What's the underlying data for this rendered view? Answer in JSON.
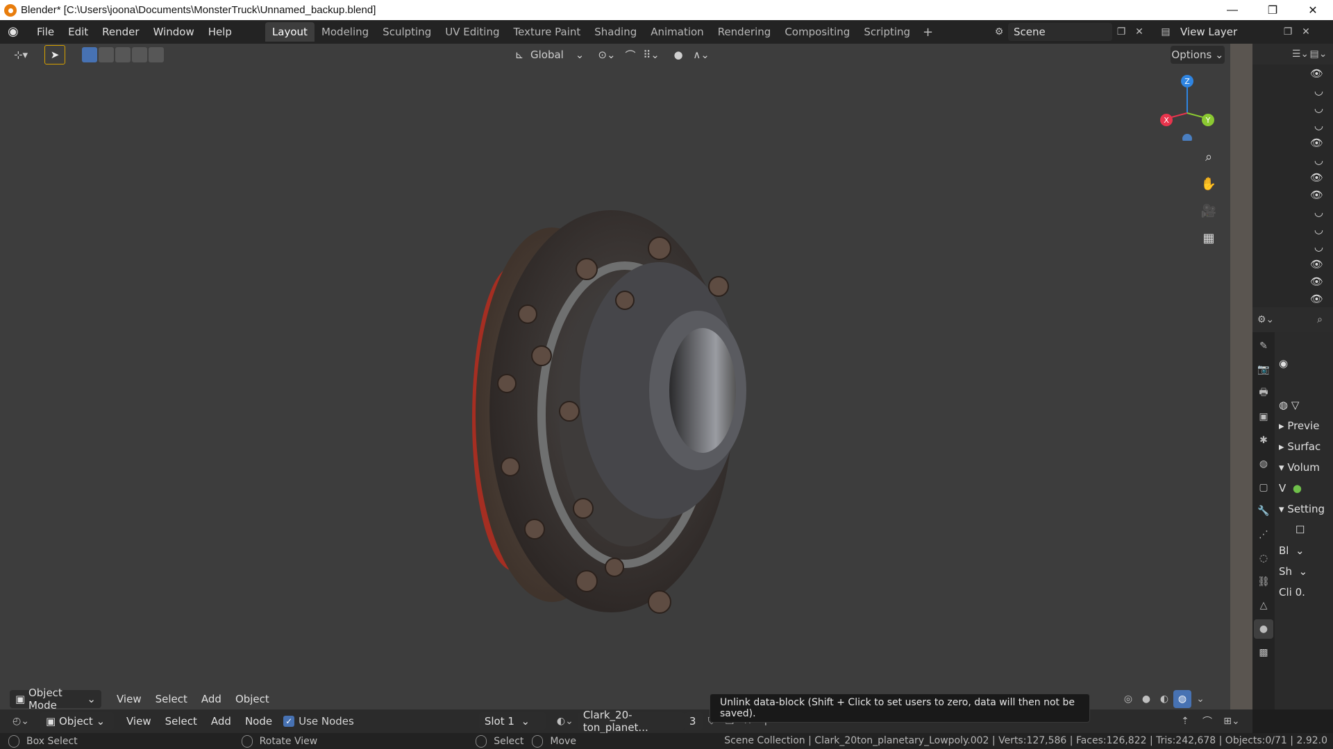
{
  "window": {
    "title": "Blender* [C:\\Users\\joona\\Documents\\MonsterTruck\\Unnamed_backup.blend]",
    "minimize": "—",
    "maximize": "❐",
    "close": "✕"
  },
  "menu": {
    "file": "File",
    "edit": "Edit",
    "render": "Render",
    "window": "Window",
    "help": "Help"
  },
  "workspaces": [
    "Layout",
    "Modeling",
    "Sculpting",
    "UV Editing",
    "Texture Paint",
    "Shading",
    "Animation",
    "Rendering",
    "Compositing",
    "Scripting"
  ],
  "workspace_add": "+",
  "scene": {
    "label": "Scene",
    "view_layer": "View Layer"
  },
  "viewport": {
    "transform_orientation": "Global",
    "options": "Options",
    "gizmo": {
      "z": "Z",
      "x": "X",
      "y": "Y"
    },
    "mode": "Object Mode",
    "view": "View",
    "select": "Select",
    "add": "Add",
    "object": "Object"
  },
  "shader_editor": {
    "type": "Object",
    "view": "View",
    "select": "Select",
    "add": "Add",
    "node": "Node",
    "use_nodes": "Use Nodes",
    "slot": "Slot 1",
    "material": "Clark_20-ton_planet...",
    "users": "3"
  },
  "tooltip": "Unlink data-block (Shift + Click to set users to zero, data will then not be saved).",
  "properties": {
    "preview": "Previe",
    "surface": "Surfac",
    "volume": "Volum",
    "v_label": "V",
    "settings": "Setting",
    "bl": "Bl",
    "sh": "Sh",
    "cl": "Cli",
    "cl_value": "0."
  },
  "statusbar": {
    "box_select": "Box Select",
    "rotate_view": "Rotate View",
    "select": "Select",
    "move": "Move",
    "stats": "Scene Collection | Clark_20ton_planetary_Lowpoly.002 | Verts:127,586 | Faces:126,822 | Tris:242,678 | Objects:0/71 | 2.92.0"
  },
  "colors": {
    "accent": "#4772b3",
    "active_tool": "#d8a200",
    "axis_x": "#e8354d",
    "axis_y": "#8bc932",
    "axis_z": "#2f85e2"
  }
}
